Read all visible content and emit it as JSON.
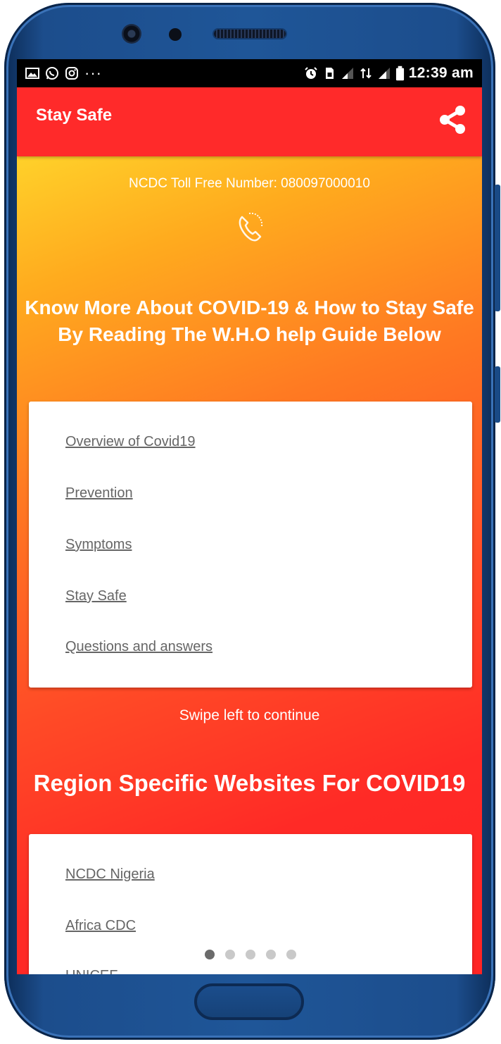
{
  "status_bar": {
    "left_icons": [
      "image-icon",
      "whatsapp-icon",
      "instagram-icon",
      "more-dots-icon"
    ],
    "more": "···",
    "time": "12:39 am"
  },
  "app_bar": {
    "title": "Stay Safe",
    "share_icon": "share-icon"
  },
  "colors": {
    "app_bar": "#ff2a2a",
    "gradient_start": "#ffd12a",
    "gradient_end": "#ff2424",
    "link": "#666666"
  },
  "tollfree": "NCDC Toll Free Number: 080097000010",
  "heading_guide": {
    "line1": "Know More About COVID-19 & How to Stay Safe",
    "line2": "By Reading The W.H.O help Guide Below"
  },
  "guide_links": [
    "Overview of Covid19",
    "Prevention",
    "Symptoms",
    "Stay Safe",
    "Questions and answers"
  ],
  "swipe_hint": "Swipe left to continue",
  "heading_regions": "Region Specific Websites For COVID19",
  "region_links": [
    "NCDC Nigeria",
    "Africa CDC",
    "UNICEF"
  ],
  "pager": {
    "count": 5,
    "active": 1
  }
}
